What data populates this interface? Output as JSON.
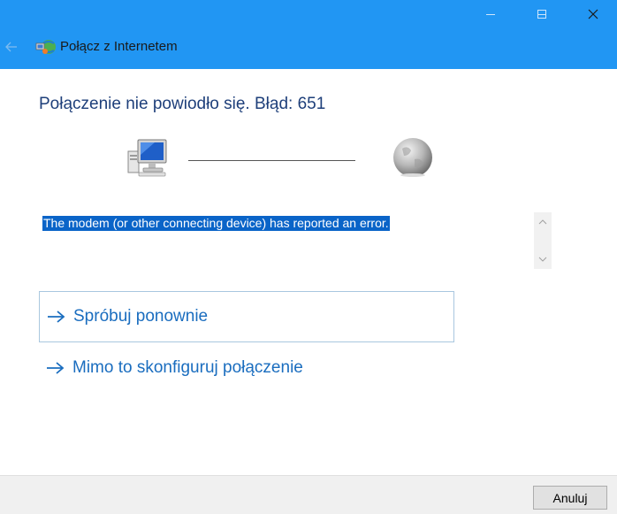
{
  "window": {
    "title": "Połącz z Internetem",
    "accent_color": "#2196f3",
    "controls": [
      "minimize-icon",
      "maximize-icon",
      "close-icon"
    ]
  },
  "main": {
    "heading": "Połączenie nie powiodło się. Błąd: 651",
    "error_message": "The modem (or other connecting device) has reported an error.",
    "error_highlight_color": "#0a64c8",
    "links": [
      {
        "label": "Spróbuj ponownie",
        "icon": "arrow-right-icon",
        "focused": true
      },
      {
        "label": "Mimo to skonfiguruj połączenie",
        "icon": "arrow-right-icon",
        "focused": false
      }
    ]
  },
  "footer": {
    "cancel_label": "Anuluj"
  }
}
